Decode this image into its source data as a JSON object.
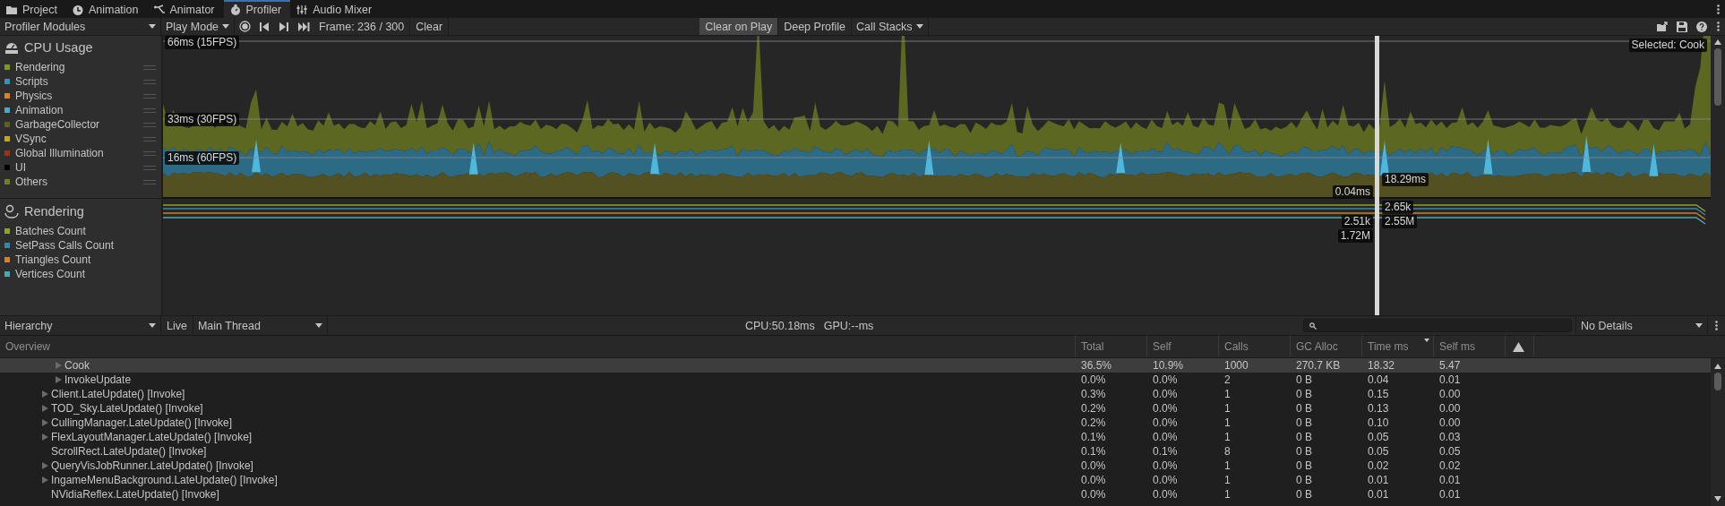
{
  "tabs": [
    {
      "label": "Project",
      "selected": false
    },
    {
      "label": "Animation",
      "selected": false
    },
    {
      "label": "Animator",
      "selected": false
    },
    {
      "label": "Profiler",
      "selected": true
    },
    {
      "label": "Audio Mixer",
      "selected": false
    }
  ],
  "toolbar": {
    "modules_dropdown": "Profiler Modules",
    "mode_dropdown": "Play Mode",
    "frame": "Frame: 236 / 300",
    "clear": "Clear",
    "toggles": [
      {
        "label": "Clear on Play",
        "on": true
      },
      {
        "label": "Deep Profile",
        "on": false
      }
    ],
    "call_stacks": "Call Stacks"
  },
  "modules": [
    {
      "title": "CPU Usage",
      "items": [
        {
          "label": "Rendering",
          "color": "#7d9a1e"
        },
        {
          "label": "Scripts",
          "color": "#3a8fb7"
        },
        {
          "label": "Physics",
          "color": "#d9822b"
        },
        {
          "label": "Animation",
          "color": "#4aa8bf"
        },
        {
          "label": "GarbageCollector",
          "color": "#5e5e24"
        },
        {
          "label": "VSync",
          "color": "#c2a720"
        },
        {
          "label": "Global Illumination",
          "color": "#9c3317"
        },
        {
          "label": "UI",
          "color": "#000000"
        },
        {
          "label": "Others",
          "color": "#6e7f24"
        }
      ]
    },
    {
      "title": "Rendering",
      "items": [
        {
          "label": "Batches Count",
          "color": "#8da325"
        },
        {
          "label": "SetPass Calls Count",
          "color": "#3a86ad"
        },
        {
          "label": "Triangles Count",
          "color": "#d08326"
        },
        {
          "label": "Vertices Count",
          "color": "#47a9b3"
        }
      ]
    }
  ],
  "graph": {
    "grid_labels": [
      "66ms (15FPS)",
      "33ms (30FPS)",
      "16ms (60FPS)"
    ],
    "selected_label": "Selected: Cook",
    "cpu_readouts": [
      "18.29ms",
      "0.04ms"
    ],
    "rendering_readouts": [
      "2.65k",
      "2.51k",
      "2.55M",
      "1.72M"
    ]
  },
  "details_toolbar": {
    "view": "Hierarchy",
    "live": {
      "label": "Live",
      "on": false
    },
    "thread": "Main Thread",
    "cpu": "CPU:50.18ms",
    "gpu": "GPU:--ms",
    "details": "No Details"
  },
  "table": {
    "columns": [
      {
        "label": "Overview",
        "sorted": false
      },
      {
        "label": "Total",
        "sorted": false
      },
      {
        "label": "Self",
        "sorted": false
      },
      {
        "label": "Calls",
        "sorted": false
      },
      {
        "label": "GC Alloc",
        "sorted": false
      },
      {
        "label": "Time ms",
        "sorted": true
      },
      {
        "label": "Self ms",
        "sorted": false
      }
    ],
    "rows": [
      {
        "children": [
          {
            "name": "Cook",
            "expandable": true,
            "selected": true,
            "cells": [
              "36.5%",
              "10.9%",
              "1000",
              "270.7 KB",
              "18.32",
              "5.47"
            ]
          },
          {
            "name": "InvokeUpdate",
            "expandable": true,
            "selected": false,
            "cells": [
              "0.0%",
              "0.0%",
              "2",
              "0 B",
              "0.04",
              "0.01"
            ]
          }
        ]
      },
      {
        "name": "Client.LateUpdate() [Invoke]",
        "expandable": true,
        "selected": false,
        "cells": [
          "0.3%",
          "0.0%",
          "1",
          "0 B",
          "0.15",
          "0.00"
        ]
      },
      {
        "name": "TOD_Sky.LateUpdate() [Invoke]",
        "expandable": true,
        "selected": false,
        "cells": [
          "0.2%",
          "0.0%",
          "1",
          "0 B",
          "0.13",
          "0.00"
        ]
      },
      {
        "name": "CullingManager.LateUpdate() [Invoke]",
        "expandable": true,
        "selected": false,
        "cells": [
          "0.2%",
          "0.0%",
          "1",
          "0 B",
          "0.10",
          "0.00"
        ]
      },
      {
        "name": "FlexLayoutManager.LateUpdate() [Invoke]",
        "expandable": true,
        "selected": false,
        "cells": [
          "0.1%",
          "0.0%",
          "1",
          "0 B",
          "0.05",
          "0.03"
        ]
      },
      {
        "name": "ScrollRect.LateUpdate() [Invoke]",
        "expandable": false,
        "selected": false,
        "cells": [
          "0.1%",
          "0.1%",
          "8",
          "0 B",
          "0.05",
          "0.05"
        ]
      },
      {
        "name": "QueryVisJobRunner.LateUpdate() [Invoke]",
        "expandable": true,
        "selected": false,
        "cells": [
          "0.0%",
          "0.0%",
          "1",
          "0 B",
          "0.02",
          "0.02"
        ]
      },
      {
        "name": "IngameMenuBackground.LateUpdate() [Invoke]",
        "expandable": true,
        "selected": false,
        "cells": [
          "0.0%",
          "0.0%",
          "1",
          "0 B",
          "0.01",
          "0.01"
        ]
      },
      {
        "name": "NVidiaReflex.LateUpdate() [Invoke]",
        "expandable": false,
        "selected": false,
        "cells": [
          "0.0%",
          "0.0%",
          "1",
          "0 B",
          "0.01",
          "0.01"
        ]
      }
    ]
  }
}
